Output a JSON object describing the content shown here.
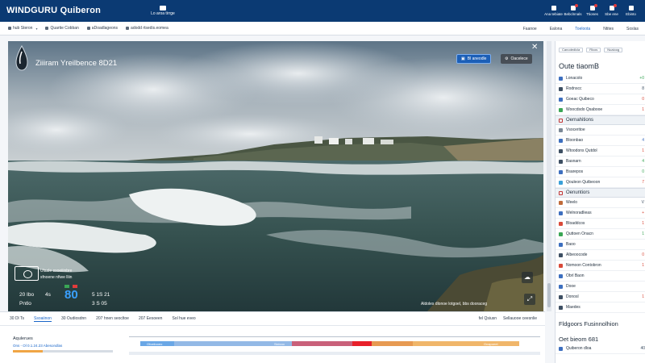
{
  "header": {
    "brand": "WINDGURU Quiberon",
    "brand_sub": "",
    "center_label": "Lo aroa tirrge",
    "right_items": [
      {
        "label": "Ana tebiate",
        "badge": false
      },
      {
        "label": "Bebclnnals",
        "badge": true
      },
      {
        "label": "Ttiones",
        "badge": true
      },
      {
        "label": "Sbe ene",
        "badge": true
      },
      {
        "label": "Ebinto",
        "badge": false
      }
    ]
  },
  "subnav": {
    "items": [
      "hub Steron",
      "Quartie Cobban",
      "aDoadlageons",
      "adodd rtsedis.eomea"
    ],
    "right_tabs": [
      "Faanoe",
      "Ealona",
      "Toeloota",
      "Ntites",
      "Soslas"
    ]
  },
  "webcam": {
    "title": "Ziiiram Yreilbence 8D21",
    "btn_primary": "Bl aneodle",
    "btn_secondary": "Oacelece",
    "overlay_lines": [
      "Ulaale ssoeiiinbre",
      "sfnoene nfiwe lliin"
    ],
    "stat_left_top": "20 Ibo",
    "stat_left_bottom": "Pntlo",
    "big_value": "80",
    "big_prefix": "4s",
    "stat_right_top": "5 1S 21",
    "stat_right_bottom": "3 S 05",
    "bottom_caption": "Aldoles dlonoe lotgoel, bbs dooraceg"
  },
  "sidebar": {
    "filters": [
      "Canodedlcla",
      "Rlcos",
      "Nuaioog"
    ],
    "heading": "Oute tiaomB",
    "groups": [
      {
        "rows": [
          {
            "label": "Lonacolo",
            "color": "#3d6fbf",
            "value": "+0",
            "vcolor": "#3aa655"
          },
          {
            "label": "Rodnscc",
            "color": "#3d4f63",
            "value": "8",
            "vcolor": "#3d4f63"
          },
          {
            "label": "Goeac Quibeco",
            "color": "#3d6fbf",
            "value": "0",
            "vcolor": "#d94a3a"
          },
          {
            "label": "Woocdsdo Qsabooe",
            "color": "#3aa655",
            "value": "1",
            "vcolor": "#d94a3a"
          }
        ]
      },
      {
        "title": "Oernahitions",
        "rows": [
          {
            "label": "Vsoceritoe",
            "color": "#7b8896",
            "value": "",
            "vcolor": "#3d4f63"
          },
          {
            "label": "Bloonbao",
            "color": "#3d6fbf",
            "value": "4",
            "vcolor": "#3d6fbf"
          },
          {
            "label": "Wtoodons Qutdol",
            "color": "#3d4f63",
            "value": "1",
            "vcolor": "#d94a3a"
          },
          {
            "label": "Basnarn",
            "color": "#3d4f63",
            "value": "4",
            "vcolor": "#3aa655"
          },
          {
            "label": "Bsarepos",
            "color": "#3d6fbf",
            "value": "0",
            "vcolor": "#3aa655"
          },
          {
            "label": "Qouleon Qutbeoon",
            "color": "#3aa0d8",
            "value": "7",
            "vcolor": "#d94a3a"
          }
        ]
      },
      {
        "title": "Oenuntiors",
        "rows": [
          {
            "label": "Weelo",
            "color": "#c06b3a",
            "value": "V",
            "vcolor": "#3d4f63"
          },
          {
            "label": "Welnoradlieas",
            "color": "#3d6fbf",
            "value": "+",
            "vcolor": "#d94a3a"
          },
          {
            "label": "Bloaddcos",
            "color": "#d94a3a",
            "value": "1",
            "vcolor": "#d94a3a"
          },
          {
            "label": "Quttoen Onacn",
            "color": "#3aa655",
            "value": "1",
            "vcolor": "#3aa655"
          },
          {
            "label": "Baoo",
            "color": "#3d6fbf",
            "value": "",
            "vcolor": "#3d4f63"
          },
          {
            "label": "Albeoocode",
            "color": "#3d4f63",
            "value": "0",
            "vcolor": "#d94a3a"
          },
          {
            "label": "Nomoon Contobron",
            "color": "#d94a3a",
            "value": "1",
            "vcolor": "#d94a3a"
          },
          {
            "label": "Obrl Baon",
            "color": "#3d6fbf",
            "value": "",
            "vcolor": "#3d4f63"
          },
          {
            "label": "Dooe",
            "color": "#3d6fbf",
            "value": "",
            "vcolor": "#3d4f63"
          },
          {
            "label": "Donosl",
            "color": "#3d4f63",
            "value": "1",
            "vcolor": "#d94a3a"
          },
          {
            "label": "Maedes",
            "color": "#3d4f63",
            "value": "",
            "vcolor": "#3d4f63"
          }
        ]
      }
    ],
    "block2_title": "Fldgoors Fusinnolhion",
    "block3_title": "Oet bieom 681",
    "block3_rows": [
      {
        "label": "Quiberon dloa",
        "value": "40",
        "vcolor": "#3d4f63"
      }
    ]
  },
  "forecast": {
    "tabs": [
      "30 Dl Ts",
      "Ssoaiinon",
      "30 Oudiosdnn",
      "207 hnen seocltoe",
      "207 Eesoeen",
      "Sol hue eveo"
    ],
    "active_tab": 1,
    "right_tabs": [
      "fel Qsiusn",
      "Sellauooe ceesnlie"
    ],
    "title": "Aqulerues",
    "subtitle": "Ons - Ol 0.1.24.23 Abesondlas",
    "bar_labels": [
      "Ofoeiiooeo",
      "Siclcoo",
      "Gnapoeet"
    ],
    "bar_segments": [
      {
        "share": 0.09,
        "color": "#6aa7e6"
      },
      {
        "share": 0.31,
        "color": "#93b9e6"
      },
      {
        "share": 0.16,
        "color": "#c9607a"
      },
      {
        "share": 0.05,
        "color": "#e8202a"
      },
      {
        "share": 0.11,
        "color": "#e79a52"
      },
      {
        "share": 0.28,
        "color": "#f0b66a"
      }
    ]
  }
}
